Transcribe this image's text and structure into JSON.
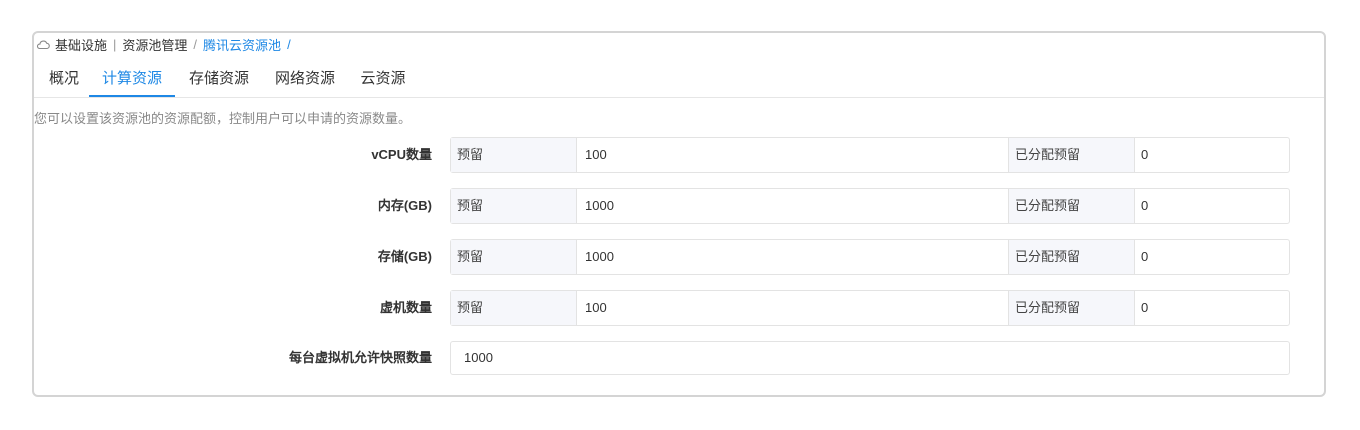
{
  "breadcrumb": {
    "icon": "cloud-icon",
    "items": [
      "基础设施",
      "资源池管理",
      "腾讯云资源池"
    ],
    "trailing_sep": "/"
  },
  "tabs": [
    {
      "label": "概况",
      "active": false
    },
    {
      "label": "计算资源",
      "active": true
    },
    {
      "label": "存储资源",
      "active": false
    },
    {
      "label": "网络资源",
      "active": false
    },
    {
      "label": "云资源",
      "active": false
    }
  ],
  "description": "您可以设置该资源池的资源配额，控制用户可以申请的资源数量。",
  "quotas": [
    {
      "label": "vCPU数量",
      "reserve_label": "预留",
      "reserve_value": "100",
      "allocated_label": "已分配预留",
      "allocated_value": "0"
    },
    {
      "label": "内存(GB)",
      "reserve_label": "预留",
      "reserve_value": "1000",
      "allocated_label": "已分配预留",
      "allocated_value": "0"
    },
    {
      "label": "存储(GB)",
      "reserve_label": "预留",
      "reserve_value": "1000",
      "allocated_label": "已分配预留",
      "allocated_value": "0"
    },
    {
      "label": "虚机数量",
      "reserve_label": "预留",
      "reserve_value": "100",
      "allocated_label": "已分配预留",
      "allocated_value": "0"
    }
  ],
  "snapshot": {
    "label": "每台虚拟机允许快照数量",
    "value": "1000"
  },
  "colors": {
    "accent": "#1e88e5",
    "border": "#d4d4d4",
    "addon_bg": "#f6f7fb"
  }
}
